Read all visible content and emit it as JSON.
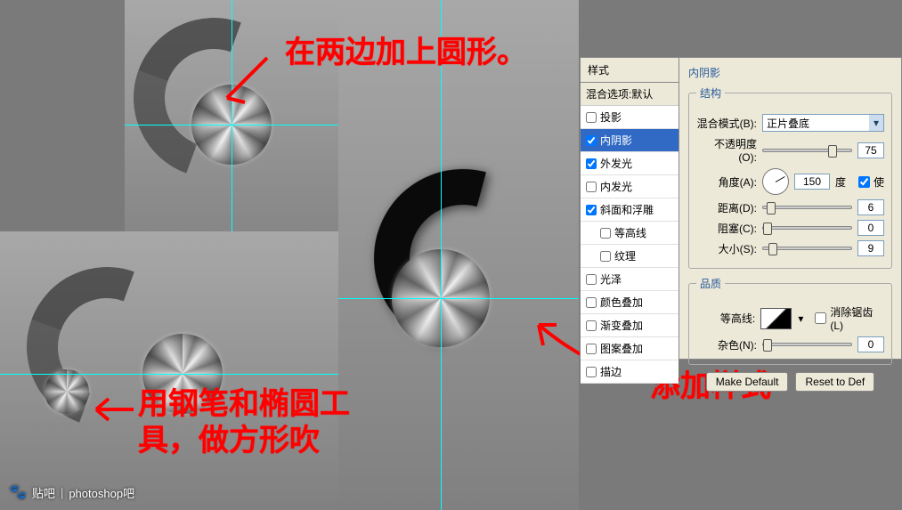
{
  "annotations": {
    "note1": "在两边加上圆形。",
    "note2": "用钢笔和椭圆工具，做方形吹",
    "note3": "添加样式"
  },
  "dialog": {
    "styles_header": "样式",
    "blend_options": "混合选项:默认",
    "effects": {
      "drop_shadow": "投影",
      "inner_shadow": "内阴影",
      "outer_glow": "外发光",
      "inner_glow": "内发光",
      "bevel": "斜面和浮雕",
      "contour": "等高线",
      "texture": "纹理",
      "satin": "光泽",
      "color_overlay": "颜色叠加",
      "gradient_overlay": "渐变叠加",
      "pattern_overlay": "图案叠加",
      "stroke": "描边"
    },
    "panel_title": "内阴影",
    "structure_title": "结构",
    "blend_mode_label": "混合模式(B):",
    "blend_mode_value": "正片叠底",
    "opacity_label": "不透明度(O):",
    "opacity_value": "75",
    "angle_label": "角度(A):",
    "angle_value": "150",
    "angle_unit": "度",
    "use_global": "使",
    "distance_label": "距离(D):",
    "distance_value": "6",
    "choke_label": "阻塞(C):",
    "choke_value": "0",
    "size_label": "大小(S):",
    "size_value": "9",
    "quality_title": "品质",
    "contour_label": "等高线:",
    "anti_alias": "消除锯齿(L)",
    "noise_label": "杂色(N):",
    "noise_value": "0",
    "make_default": "Make Default",
    "reset_default": "Reset to Def"
  },
  "watermark": {
    "brand": "贴吧",
    "forum": "photoshop吧"
  }
}
